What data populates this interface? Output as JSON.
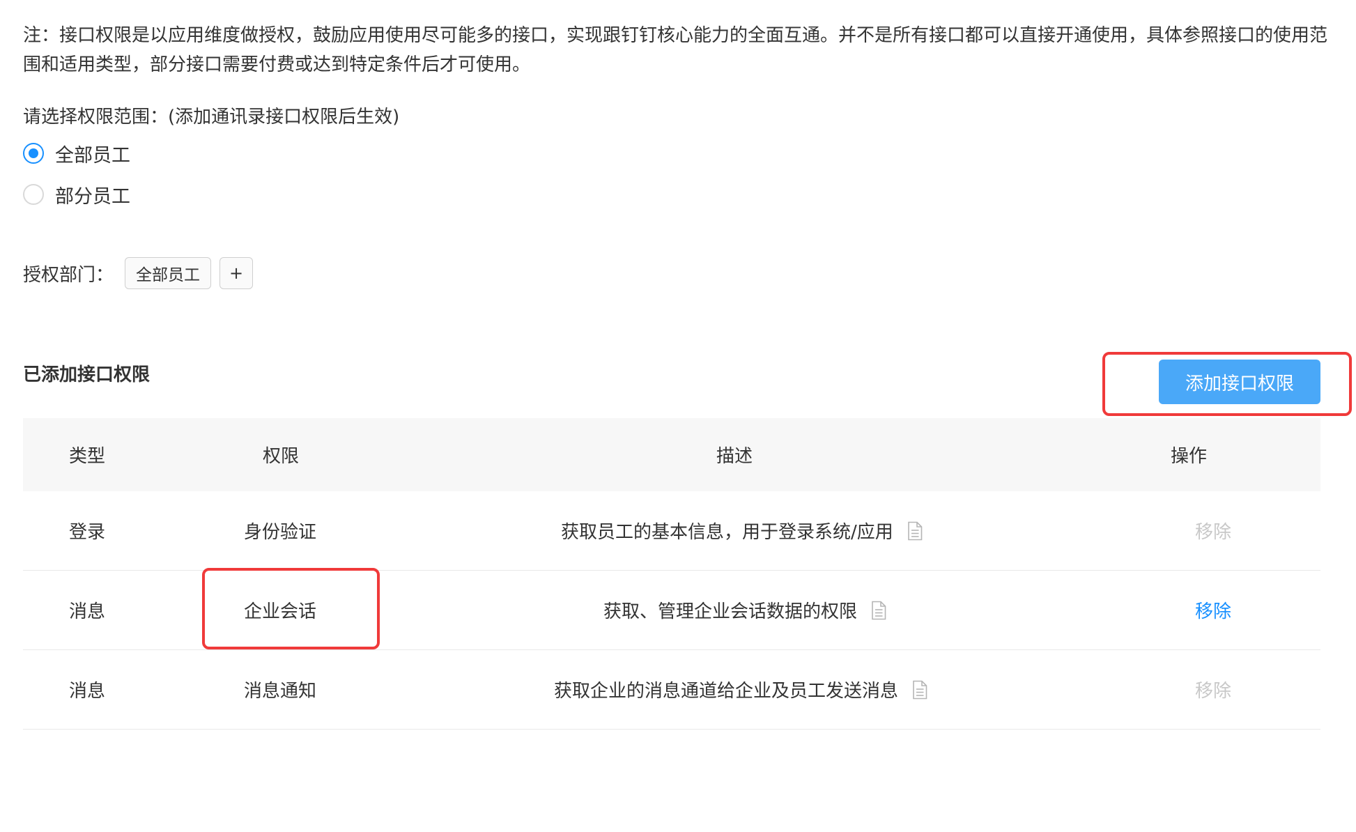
{
  "note": {
    "text": "注：接口权限是以应用维度做授权，鼓励应用使用尽可能多的接口，实现跟钉钉核心能力的全面互通。并不是所有接口都可以直接开通使用，具体参照接口的使用范围和适用类型，部分接口需要付费或达到特定条件后才可使用。"
  },
  "scope": {
    "title": "请选择权限范围：(添加通讯录接口权限后生效)",
    "options": [
      {
        "label": "全部员工",
        "checked": true
      },
      {
        "label": "部分员工",
        "checked": false
      }
    ]
  },
  "department": {
    "label": "授权部门：",
    "tag": "全部员工",
    "add_label": "+"
  },
  "section": {
    "title": "已添加接口权限",
    "add_button_label": "添加接口权限"
  },
  "table": {
    "headers": {
      "type": "类型",
      "permission": "权限",
      "description": "描述",
      "operation": "操作"
    },
    "rows": [
      {
        "type": "登录",
        "permission": "身份验证",
        "description": "获取员工的基本信息，用于登录系统/应用",
        "operation": "移除",
        "operation_enabled": false
      },
      {
        "type": "消息",
        "permission": "企业会话",
        "description": "获取、管理企业会话数据的权限",
        "operation": "移除",
        "operation_enabled": true
      },
      {
        "type": "消息",
        "permission": "消息通知",
        "description": "获取企业的消息通道给企业及员工发送消息",
        "operation": "移除",
        "operation_enabled": false
      }
    ]
  },
  "icons": {
    "description_doc": "document-icon"
  },
  "colors": {
    "accent": "#1890ff",
    "button_bg": "#4aa8f8",
    "highlight_border": "#f03a3a",
    "disabled_text": "#c8c8c8",
    "header_bg": "#f7f7f7"
  }
}
